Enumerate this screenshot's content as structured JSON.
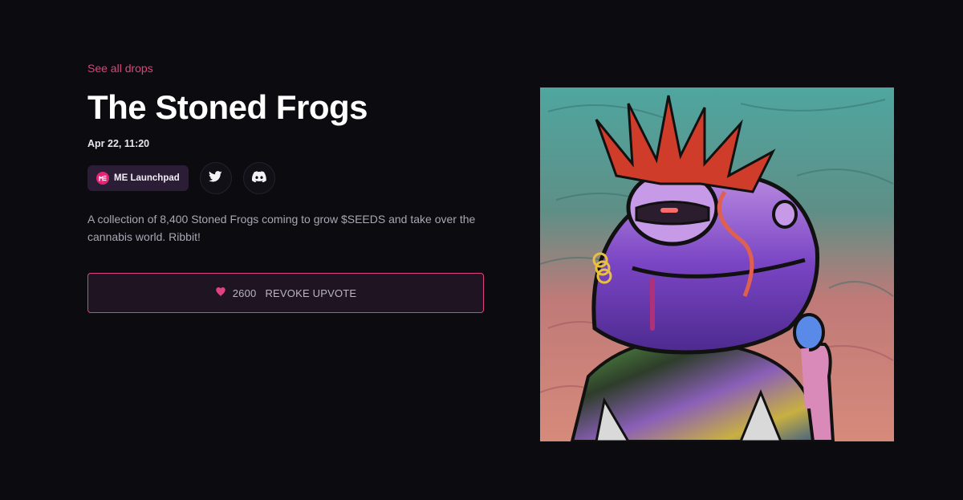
{
  "nav": {
    "back_link": "See all drops"
  },
  "drop": {
    "title": "The Stoned Frogs",
    "date": "Apr 22, 11:20",
    "launchpad_label": "ME Launchpad",
    "description": "A collection of 8,400 Stoned Frogs coming to grow $SEEDS and take over the cannabis world. Ribbit!"
  },
  "upvote": {
    "count": "2600",
    "label": "REVOKE UPVOTE"
  },
  "icons": {
    "heart": "heart-icon",
    "twitter": "twitter-icon",
    "discord": "discord-icon",
    "launchpad": "magic-eden-logo"
  },
  "colors": {
    "accent": "#e0427f",
    "background": "#0c0b10"
  }
}
